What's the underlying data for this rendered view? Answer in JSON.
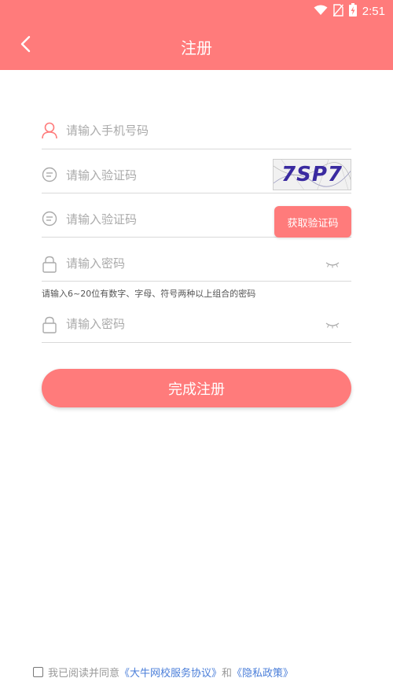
{
  "status_bar": {
    "time": "2:51"
  },
  "header": {
    "title": "注册"
  },
  "form": {
    "phone_placeholder": "请输入手机号码",
    "captcha_placeholder": "请输入验证码",
    "captcha_image_text": "7SP7",
    "sms_code_placeholder": "请输入验证码",
    "sms_button_label": "获取验证码",
    "password_placeholder": "请输入密码",
    "password_hint": "请输入6~20位有数字、字母、符号两种以上组合的密码",
    "confirm_password_placeholder": "请输入密码",
    "submit_label": "完成注册"
  },
  "agreement": {
    "prefix": "我已阅读并同意",
    "terms_link": "《大牛网校服务协议》",
    "conjunction": "和",
    "privacy_link": "《隐私政策》"
  },
  "colors": {
    "accent": "#ff7b7b",
    "link": "#4a7ed9"
  }
}
